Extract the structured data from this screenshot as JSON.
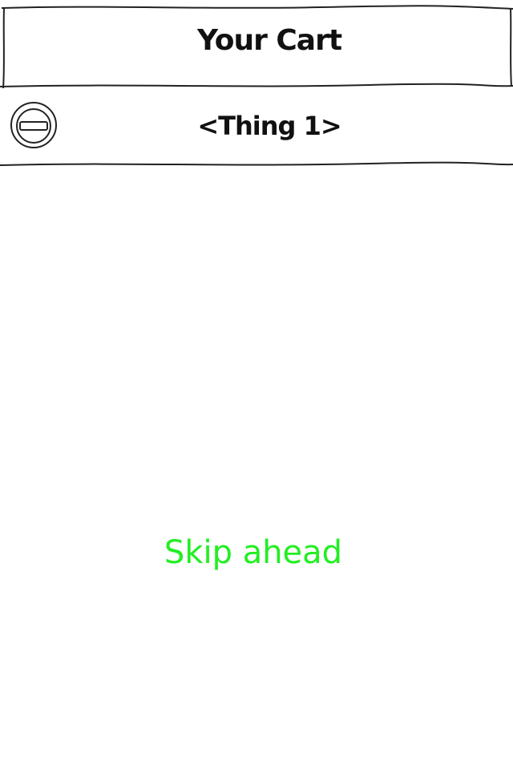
{
  "header": {
    "title": "Your Cart"
  },
  "cart": {
    "items": [
      {
        "name": "<Thing 1>",
        "remove_icon": "minus-circle-icon"
      }
    ]
  },
  "skip": {
    "label": "Skip ahead",
    "color": "#22ee22"
  }
}
